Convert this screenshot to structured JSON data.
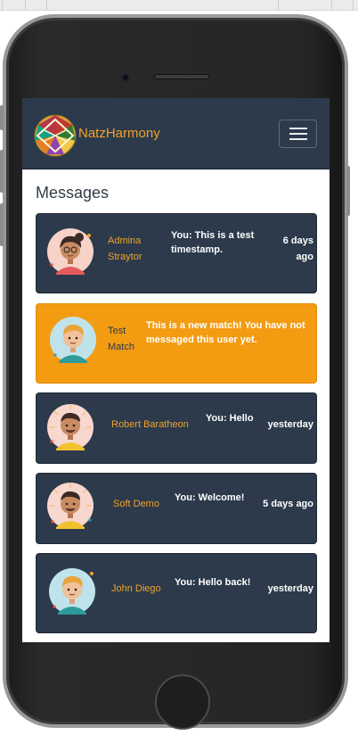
{
  "app": {
    "brand": "NatzHarmony"
  },
  "page": {
    "heading": "Messages"
  },
  "conversations": [
    {
      "name": "Admina Straytor",
      "message": "You: This is a test timestamp.",
      "time": "6 days ago",
      "type": "chat"
    },
    {
      "name": "Test Match",
      "message": "This is a new match! You have not messaged this user yet.",
      "time": "",
      "type": "match"
    },
    {
      "name": "Robert Baratheon",
      "message": "You: Hello",
      "time": "yesterday",
      "type": "chat"
    },
    {
      "name": "Soft Demo",
      "message": "You: Welcome!",
      "time": "5 days ago",
      "type": "chat"
    },
    {
      "name": "John Diego",
      "message": "You: Hello back!",
      "time": "yesterday",
      "type": "chat"
    }
  ],
  "colors": {
    "navbar": "#2c3a4b",
    "accent": "#f0a32a",
    "match_card": "#f39c12",
    "chat_card": "#2c3a4b"
  },
  "icons": {
    "menu": "hamburger-icon",
    "logo": "brand-logo",
    "avatar": "avatar-illustration"
  }
}
